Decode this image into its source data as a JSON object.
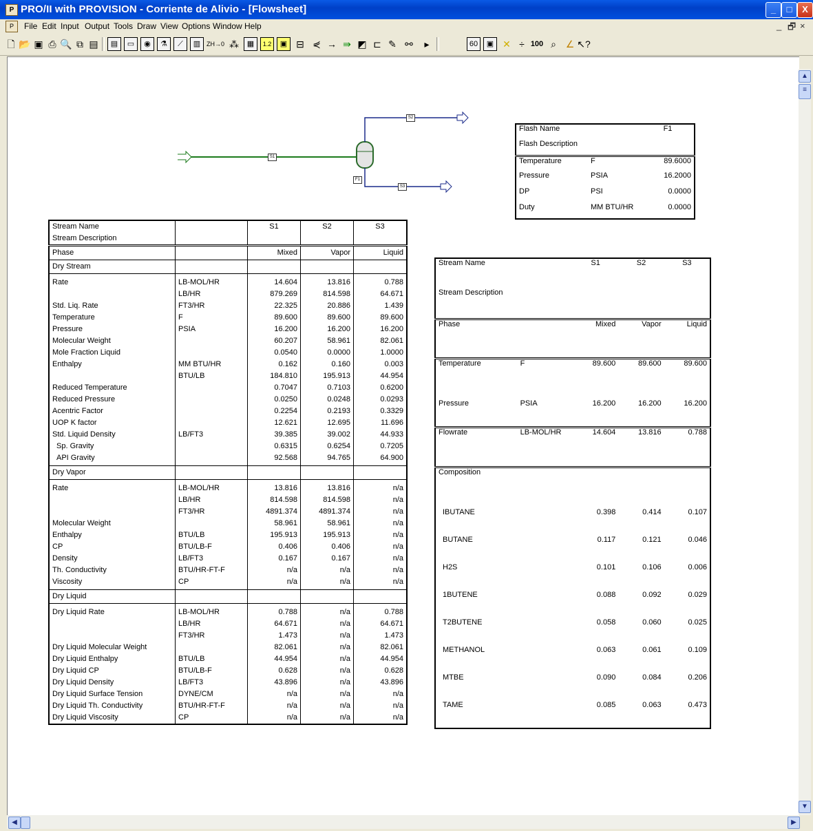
{
  "window": {
    "title": "PRO/II with PROVISION - Corriente de Alivio - [Flowsheet]",
    "app_icon": "proii-icon",
    "min": "_",
    "max": "□",
    "close": "X"
  },
  "menu": [
    "File",
    "Edit",
    "Input",
    "Output",
    "Tools",
    "Draw",
    "View",
    "Options",
    "Window",
    "Help"
  ],
  "mdi_controls": {
    "min": "_",
    "restore": "🗗",
    "close": "×"
  },
  "toolbar": {
    "icons": [
      "new-icon",
      "open-icon",
      "save-icon",
      "print-icon",
      "print-preview-icon",
      "copy-icon",
      "calculator-icon",
      "form-icon",
      "keyword-icon",
      "run-icon",
      "flask-icon",
      "plot-icon",
      "bar-chart-icon",
      "zh-icon",
      "units-icon",
      "table-icon",
      "number-icon",
      "zoom-box-icon",
      "separator-icon",
      "mixer-icon",
      "stream-icon",
      "pump-icon",
      "reactor-icon",
      "exchanger-icon",
      "pencil-icon",
      "binocular-icon",
      "play-icon",
      "report-icon",
      "copy2-icon",
      "cross-icon",
      "step-icon",
      "zoom100-icon",
      "zoom-icon",
      "draw-icon",
      "help-icon"
    ],
    "zh_label": "ZH→0",
    "hundred_label": "100"
  },
  "flowsheet": {
    "streams": {
      "feed": "S1",
      "vapor": "S2",
      "liquid": "S3"
    },
    "unit": "F1"
  },
  "stream_table": {
    "header": {
      "c0": [
        "Stream Name",
        "Stream Description"
      ],
      "c2": "S1",
      "c3": "S2",
      "c4": "S3"
    },
    "phase": {
      "label": "Phase",
      "s1": "Mixed",
      "s2": "Vapor",
      "s3": "Liquid"
    },
    "dry_stream": {
      "title": "Dry Stream",
      "names": [
        "Rate",
        "",
        "Std. Liq. Rate",
        "Temperature",
        "Pressure",
        "Molecular Weight",
        "Mole Fraction Liquid",
        "Enthalpy",
        "",
        "Reduced Temperature",
        "Reduced Pressure",
        "Acentric Factor",
        "UOP K factor",
        "Std. Liquid Density",
        "  Sp. Gravity",
        "  API Gravity"
      ],
      "units": [
        "LB-MOL/HR",
        "LB/HR",
        "FT3/HR",
        "F",
        "PSIA",
        "",
        "",
        "MM BTU/HR",
        "BTU/LB",
        "",
        "",
        "",
        "",
        "LB/FT3",
        "",
        ""
      ],
      "s1": [
        "14.604",
        "879.269",
        "22.325",
        "89.600",
        "16.200",
        "60.207",
        "0.0540",
        "0.162",
        "184.810",
        "0.7047",
        "0.0250",
        "0.2254",
        "12.621",
        "39.385",
        "0.6315",
        "92.568"
      ],
      "s2": [
        "13.816",
        "814.598",
        "20.886",
        "89.600",
        "16.200",
        "58.961",
        "0.0000",
        "0.160",
        "195.913",
        "0.7103",
        "0.0248",
        "0.2193",
        "12.695",
        "39.002",
        "0.6254",
        "94.765"
      ],
      "s3": [
        "0.788",
        "64.671",
        "1.439",
        "89.600",
        "16.200",
        "82.061",
        "1.0000",
        "0.003",
        "44.954",
        "0.6200",
        "0.0293",
        "0.3329",
        "11.696",
        "44.933",
        "0.7205",
        "64.900"
      ]
    },
    "dry_vapor": {
      "title": "Dry Vapor",
      "names": [
        "Rate",
        "",
        "",
        "Molecular Weight",
        "Enthalpy",
        "CP",
        "Density",
        "Th. Conductivity",
        "Viscosity"
      ],
      "units": [
        "LB-MOL/HR",
        "LB/HR",
        "FT3/HR",
        "",
        "BTU/LB",
        "BTU/LB-F",
        "LB/FT3",
        "BTU/HR-FT-F",
        "CP"
      ],
      "s1": [
        "13.816",
        "814.598",
        "4891.374",
        "58.961",
        "195.913",
        "0.406",
        "0.167",
        "n/a",
        "n/a"
      ],
      "s2": [
        "13.816",
        "814.598",
        "4891.374",
        "58.961",
        "195.913",
        "0.406",
        "0.167",
        "n/a",
        "n/a"
      ],
      "s3": [
        "n/a",
        "n/a",
        "n/a",
        "n/a",
        "n/a",
        "n/a",
        "n/a",
        "n/a",
        "n/a"
      ]
    },
    "dry_liquid": {
      "title": "Dry Liquid",
      "names": [
        "Dry Liquid Rate",
        "",
        "",
        "Dry Liquid Molecular Weight",
        "Dry Liquid Enthalpy",
        "Dry Liquid CP",
        "Dry Liquid Density",
        "Dry Liquid Surface Tension",
        "Dry Liquid Th. Conductivity",
        "Dry Liquid Viscosity"
      ],
      "units": [
        "LB-MOL/HR",
        "LB/HR",
        "FT3/HR",
        "",
        "BTU/LB",
        "BTU/LB-F",
        "LB/FT3",
        "DYNE/CM",
        "BTU/HR-FT-F",
        "CP"
      ],
      "s1": [
        "0.788",
        "64.671",
        "1.473",
        "82.061",
        "44.954",
        "0.628",
        "43.896",
        "n/a",
        "n/a",
        "n/a"
      ],
      "s2": [
        "n/a",
        "n/a",
        "n/a",
        "n/a",
        "n/a",
        "n/a",
        "n/a",
        "n/a",
        "n/a",
        "n/a"
      ],
      "s3": [
        "0.788",
        "64.671",
        "1.473",
        "82.061",
        "44.954",
        "0.628",
        "43.896",
        "n/a",
        "n/a",
        "n/a"
      ]
    }
  },
  "summary_table": {
    "stream_name": "Stream Name",
    "stream_desc": "Stream Description",
    "cols": [
      "S1",
      "S2",
      "S3"
    ],
    "phase": {
      "label": "Phase",
      "vals": [
        "Mixed",
        "Vapor",
        "Liquid"
      ]
    },
    "temperature": {
      "label": "Temperature",
      "unit": "F",
      "vals": [
        "89.600",
        "89.600",
        "89.600"
      ]
    },
    "pressure": {
      "label": "Pressure",
      "unit": "PSIA",
      "vals": [
        "16.200",
        "16.200",
        "16.200"
      ]
    },
    "flowrate": {
      "label": "Flowrate",
      "unit": "LB-MOL/HR",
      "vals": [
        "14.604",
        "13.816",
        "0.788"
      ]
    },
    "composition_label": "Composition",
    "components": [
      {
        "name": "IBUTANE",
        "vals": [
          "0.398",
          "0.414",
          "0.107"
        ]
      },
      {
        "name": "BUTANE",
        "vals": [
          "0.117",
          "0.121",
          "0.046"
        ]
      },
      {
        "name": "H2S",
        "vals": [
          "0.101",
          "0.106",
          "0.006"
        ]
      },
      {
        "name": "1BUTENE",
        "vals": [
          "0.088",
          "0.092",
          "0.029"
        ]
      },
      {
        "name": "T2BUTENE",
        "vals": [
          "0.058",
          "0.060",
          "0.025"
        ]
      },
      {
        "name": "METHANOL",
        "vals": [
          "0.063",
          "0.061",
          "0.109"
        ]
      },
      {
        "name": "MTBE",
        "vals": [
          "0.090",
          "0.084",
          "0.206"
        ]
      },
      {
        "name": "TAME",
        "vals": [
          "0.085",
          "0.063",
          "0.473"
        ]
      }
    ]
  },
  "flash_table": {
    "name_label": "Flash Name",
    "desc_label": "Flash Description",
    "name": "F1",
    "rows": [
      {
        "label": "Temperature",
        "unit": "F",
        "val": "89.6000"
      },
      {
        "label": "Pressure",
        "unit": "PSIA",
        "val": "16.2000"
      },
      {
        "label": "DP",
        "unit": "PSI",
        "val": "0.0000"
      },
      {
        "label": "Duty",
        "unit": "MM BTU/HR",
        "val": "0.0000"
      }
    ]
  }
}
